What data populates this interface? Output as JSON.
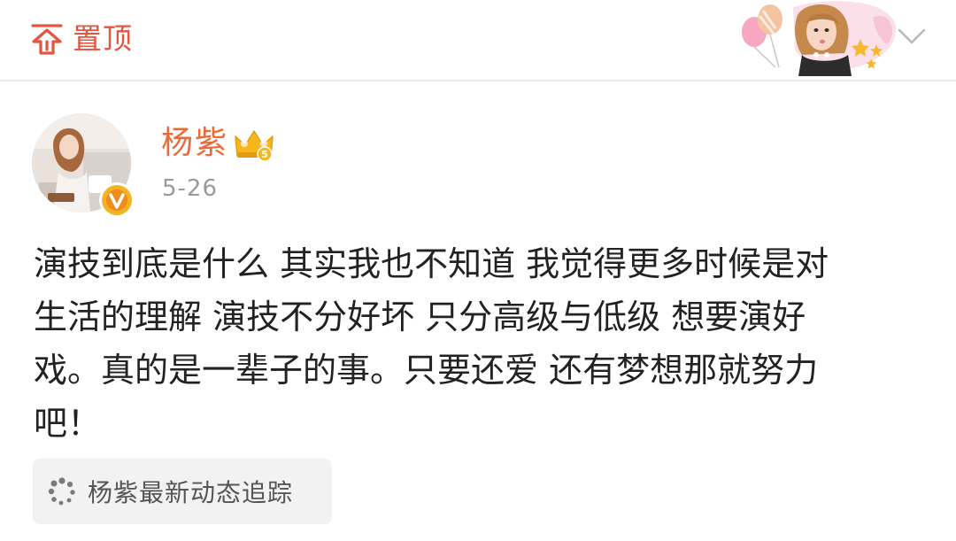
{
  "topbar": {
    "pin_label": "置顶",
    "pin_icon": "pin-to-top-icon",
    "badge_icon": "decorative-avatar-card-icon",
    "more_icon": "chevron-down-icon",
    "accent_color": "#e6543f"
  },
  "author": {
    "name": "杨紫",
    "post_date": "5-26",
    "crown_level_icon": "vip-crown-icon",
    "verify_icon": "verified-v-icon",
    "name_color": "#e96b3b"
  },
  "post": {
    "text": "演技到底是什么 其实我也不知道 我觉得更多时候是对\n生活的理解 演技不分好坏 只分高级与低级 想要演好\n戏。真的是一辈子的事。只要还爱 还有梦想那就努力\n吧！"
  },
  "topic": {
    "label": "杨紫最新动态追踪",
    "icon": "loading-dots-icon"
  }
}
